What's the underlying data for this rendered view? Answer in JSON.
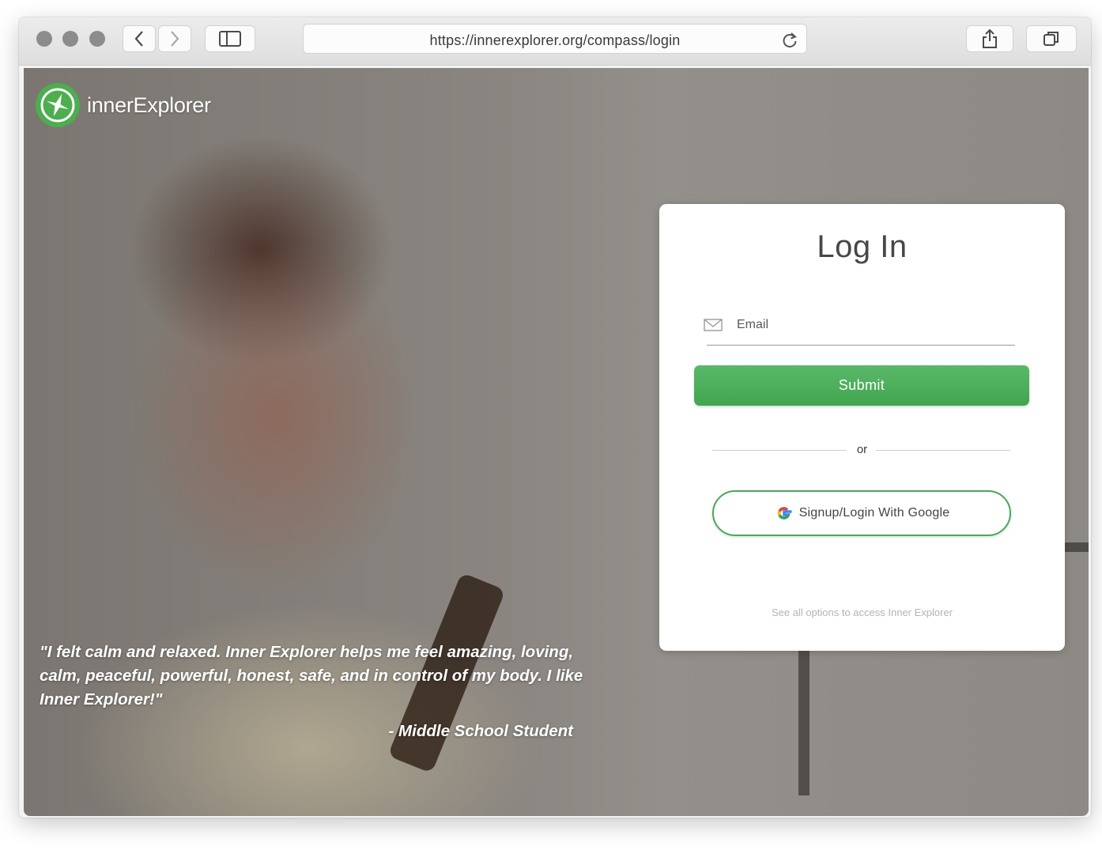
{
  "browser": {
    "url": "https://innerexplorer.org/compass/login",
    "icons": {
      "back": "chevron-left-icon",
      "forward": "chevron-right-icon",
      "sidebar": "sidebar-icon",
      "reload": "reload-icon",
      "share": "share-icon",
      "tabs": "tabs-icon"
    }
  },
  "brand": {
    "name": "innerExplorer",
    "logo_icon": "compass-icon",
    "logo_color": "#4cae4f"
  },
  "hero": {
    "quote": "\"I felt calm and relaxed. Inner Explorer helps me feel amazing, loving, calm, peaceful, powerful, honest, safe, and in control of my body. I like Inner Explorer!\"",
    "attribution": "- Middle School Student"
  },
  "login": {
    "title": "Log In",
    "email_placeholder": "Email",
    "email_value": "",
    "email_icon": "envelope-icon",
    "submit_label": "Submit",
    "submit_color": "#4caf50",
    "divider_text": "or",
    "google_label": "Signup/Login With Google",
    "google_icon": "google-icon",
    "options_link": "See all options to access Inner Explorer"
  }
}
